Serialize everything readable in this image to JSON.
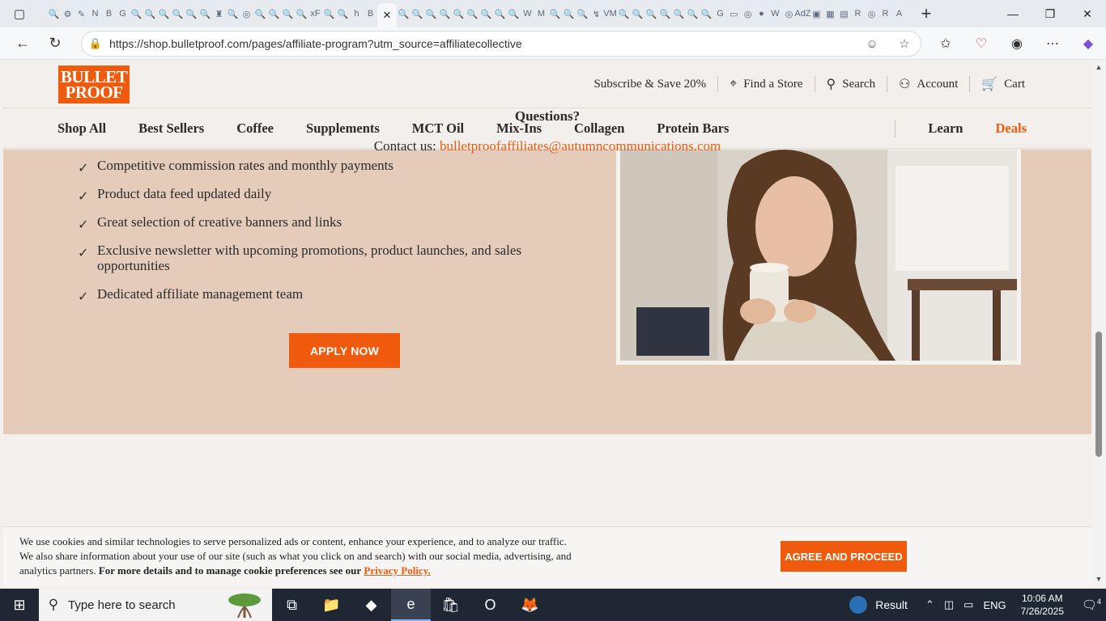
{
  "browser": {
    "url": "https://shop.bulletproof.com/pages/affiliate-program?utm_source=affiliatecollective",
    "tab_favicons": [
      "🔍",
      "⚙",
      "✎",
      "N",
      "B",
      "G",
      "🔍",
      "🔍",
      "🔍",
      "🔍",
      "🔍",
      "🔍",
      "♜",
      "🔍",
      "◎",
      "🔍",
      "🔍",
      "🔍",
      "🔍",
      "xF",
      "🔍",
      "🔍",
      "h",
      "B"
    ],
    "tab_favicons_right": [
      "🔍",
      "🔍",
      "🔍",
      "🔍",
      "🔍",
      "🔍",
      "🔍",
      "🔍",
      "🔍",
      "W",
      "M",
      "🔍",
      "🔍",
      "🔍",
      "↯",
      "VM",
      "🔍",
      "🔍",
      "🔍",
      "🔍",
      "🔍",
      "🔍",
      "🔍",
      "G",
      "▭",
      "◎",
      "●",
      "W",
      "◎",
      "AdZ",
      "▣",
      "▦",
      "▤",
      "R",
      "◎",
      "R",
      "A"
    ],
    "active_tab_glyph": "✕",
    "new_tab": "+",
    "window": {
      "minimize": "—",
      "maximize": "❐",
      "close": "✕"
    }
  },
  "header": {
    "logo": {
      "line1": "BULLET",
      "line2": "PROOF"
    },
    "utility": [
      {
        "label": "Subscribe & Save 20%",
        "icon": ""
      },
      {
        "label": "Find a Store",
        "icon": "⌖"
      },
      {
        "label": "Search",
        "icon": "⚲"
      },
      {
        "label": "Account",
        "icon": "⚇"
      },
      {
        "label": "Cart",
        "icon": "🛒"
      }
    ],
    "nav": [
      "Shop All",
      "Best Sellers",
      "Coffee",
      "Supplements",
      "MCT Oil",
      "Mix-Ins",
      "Collagen",
      "Protein Bars"
    ],
    "learn": "Learn",
    "deals": "Deals"
  },
  "benefits": {
    "items": [
      "Competitive commission rates and monthly payments",
      "Product data feed updated daily",
      "Great selection of creative banners and links",
      "Exclusive newsletter with upcoming promotions, product launches, and sales opportunities",
      "Dedicated affiliate management team"
    ],
    "check_glyph": "✓",
    "apply_label": "APPLY NOW"
  },
  "questions": {
    "title": "Questions?",
    "contact_label": "Contact us:",
    "email": "bulletproofaffiliates@autumncommunications.com"
  },
  "cookie": {
    "text": "We use cookies and similar technologies to serve personalized ads or content, enhance your experience, and to analyze our traffic. We also share information about your use of our site (such as what you click on and search) with our social media, advertising, and analytics partners.",
    "bold_text": "For more details and to manage cookie preferences see our",
    "privacy_link": "Privacy Policy.",
    "agree_label": "AGREE AND PROCEED"
  },
  "taskbar": {
    "search_placeholder": "Type here to search",
    "apps": [
      "⧉",
      "📁",
      "◆",
      "e",
      "🛍",
      "O",
      "🦊"
    ],
    "result_label": "Result",
    "lang": "ENG",
    "time": "10:06 AM",
    "date": "7/26/2025",
    "notification_count": "4"
  },
  "colors": {
    "brand_orange": "#f05a0c",
    "band": "#e4cbba",
    "page_bg": "#f2efec"
  }
}
